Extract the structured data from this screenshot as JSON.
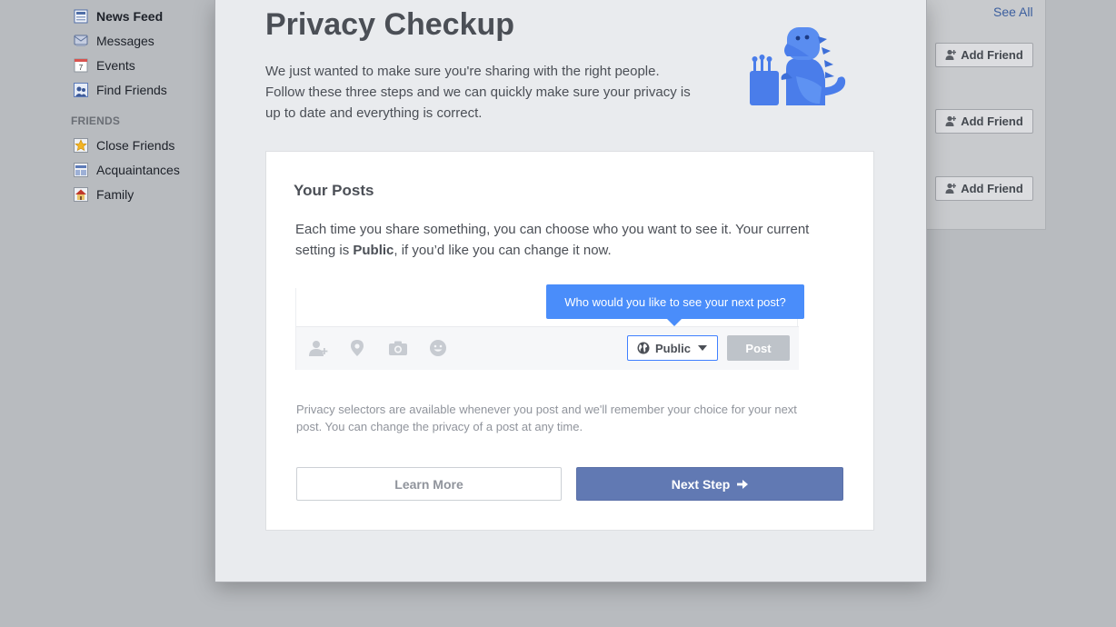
{
  "sidebar": {
    "items": [
      {
        "label": "News Feed",
        "icon": "news-feed-icon"
      },
      {
        "label": "Messages",
        "icon": "messages-icon"
      },
      {
        "label": "Events",
        "icon": "events-icon",
        "badge": "7"
      },
      {
        "label": "Find Friends",
        "icon": "find-friends-icon"
      }
    ],
    "friends_heading": "FRIENDS",
    "friend_lists": [
      {
        "label": "Close Friends",
        "icon": "star-icon"
      },
      {
        "label": "Acquaintances",
        "icon": "acquaintances-icon"
      },
      {
        "label": "Family",
        "icon": "house-icon"
      }
    ]
  },
  "right_panel": {
    "see_all": "See All",
    "add_friend_label": "Add Friend"
  },
  "modal": {
    "title": "Privacy Checkup",
    "intro": "We just wanted to make sure you're sharing with the right people. Follow these three steps and we can quickly make sure your privacy is up to date and everything is correct.",
    "card": {
      "title": "Your Posts",
      "desc_part1": "Each time you share something, you can choose who you want to see it. Your current setting is ",
      "desc_bold": "Public",
      "desc_part2": ", if you’d like you can change it now.",
      "tooltip": "Who would you like to see your next post?",
      "privacy_value": "Public",
      "post_label": "Post",
      "note": "Privacy selectors are available whenever you post and we'll remember your choice for your next post. You can change the privacy of a post at any time.",
      "learn_more": "Learn More",
      "next_step": "Next Step"
    }
  },
  "colors": {
    "accent_blue": "#4a8dfa",
    "next_button": "#6179b3",
    "dino": "#4a7dea"
  }
}
